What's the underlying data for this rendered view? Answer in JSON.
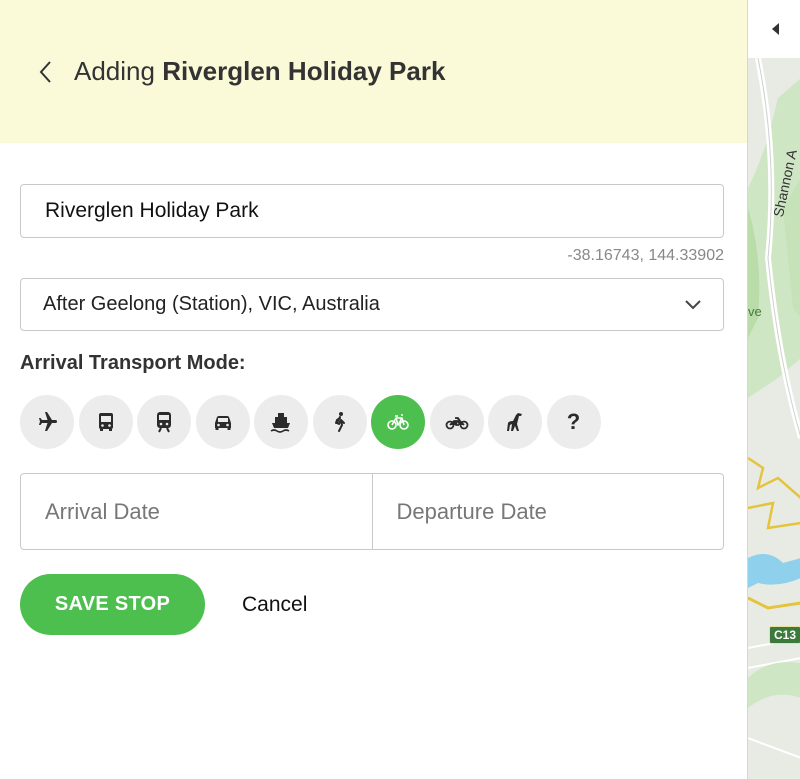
{
  "header": {
    "prefix": "Adding",
    "place_name": "Riverglen Holiday Park"
  },
  "form": {
    "name_value": "Riverglen Holiday Park",
    "coordinates": "-38.16743, 144.33902",
    "position_select": "After Geelong (Station), VIC, Australia",
    "transport_label": "Arrival Transport Mode:",
    "transport_modes": [
      {
        "icon": "plane-icon",
        "active": false
      },
      {
        "icon": "bus-icon",
        "active": false
      },
      {
        "icon": "train-icon",
        "active": false
      },
      {
        "icon": "car-icon",
        "active": false
      },
      {
        "icon": "ship-icon",
        "active": false
      },
      {
        "icon": "walk-icon",
        "active": false
      },
      {
        "icon": "bicycle-icon",
        "active": true
      },
      {
        "icon": "motorcycle-icon",
        "active": false
      },
      {
        "icon": "giraffe-icon",
        "active": false
      },
      {
        "icon": "question-icon",
        "active": false,
        "glyph": "?"
      }
    ],
    "arrival_placeholder": "Arrival Date",
    "departure_placeholder": "Departure Date"
  },
  "actions": {
    "save_label": "SAVE STOP",
    "cancel_label": "Cancel"
  },
  "map": {
    "road_label": "Shannon A",
    "park_label": "ve",
    "route_badge": "C13"
  },
  "colors": {
    "header_bg": "#fafad8",
    "accent_green": "#4dbf4f",
    "mode_bg": "#ececec"
  }
}
